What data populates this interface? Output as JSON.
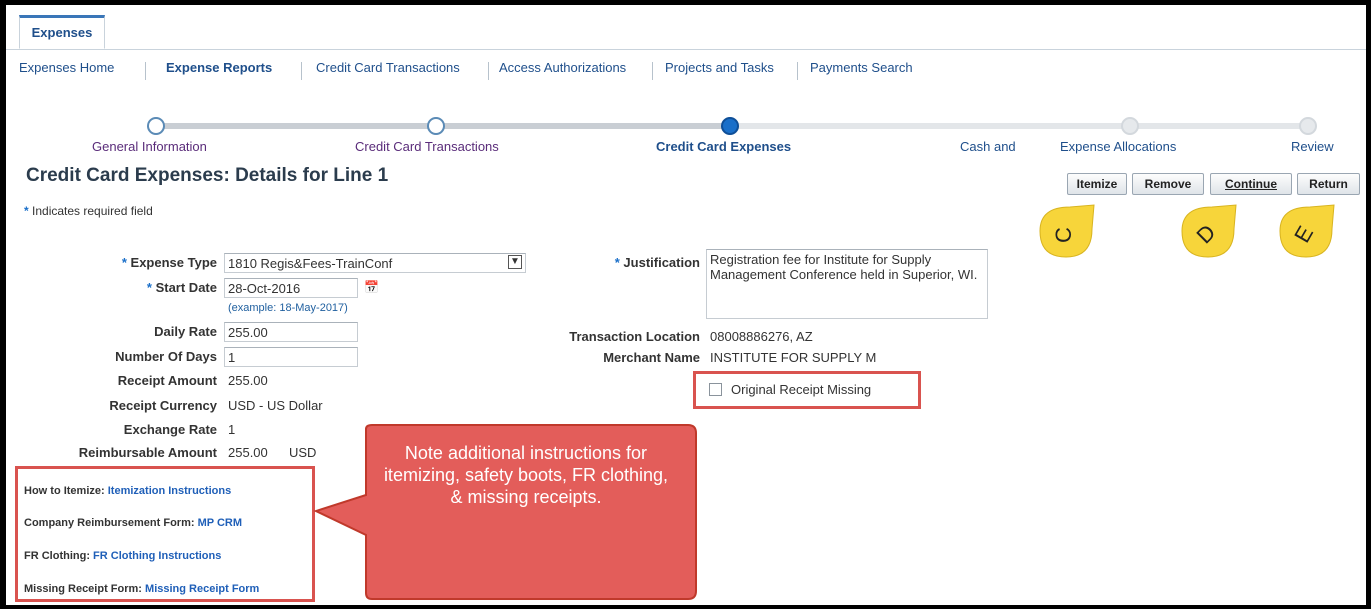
{
  "top_tab": "Expenses",
  "nav": [
    {
      "label": "Expenses Home",
      "active": false
    },
    {
      "label": "Expense Reports",
      "active": true
    },
    {
      "label": "Credit Card Transactions",
      "active": false
    },
    {
      "label": "Access Authorizations",
      "active": false
    },
    {
      "label": "Projects and Tasks",
      "active": false
    },
    {
      "label": "Payments Search",
      "active": false
    }
  ],
  "train": [
    {
      "label": "General Information",
      "state": "done"
    },
    {
      "label": "Credit Card Transactions",
      "state": "done"
    },
    {
      "label": "Credit Card Expenses",
      "state": "current"
    },
    {
      "label": "Cash and",
      "state": "todo"
    },
    {
      "label": "Expense Allocations",
      "state": "todo"
    },
    {
      "label": "Review",
      "state": "todo"
    }
  ],
  "page_title": "Credit Card Expenses: Details for Line 1",
  "buttons": {
    "itemize": "Itemize",
    "remove": "Remove",
    "continue": "Continue",
    "return": "Return"
  },
  "required_note": "Indicates required field",
  "required_star": "*",
  "form": {
    "expense_type_label": "Expense Type",
    "expense_type_value": "1810 Regis&Fees-TrainConf",
    "start_date_label": "Start Date",
    "start_date_value": "28-Oct-2016",
    "start_date_hint": "(example: 18-May-2017)",
    "daily_rate_label": "Daily Rate",
    "daily_rate_value": "255.00",
    "num_days_label": "Number Of Days",
    "num_days_value": "1",
    "receipt_amount_label": "Receipt Amount",
    "receipt_amount_value": "255.00",
    "receipt_currency_label": "Receipt Currency",
    "receipt_currency_value": "USD - US Dollar",
    "exchange_rate_label": "Exchange Rate",
    "exchange_rate_value": "1",
    "reimbursable_label": "Reimbursable Amount",
    "reimbursable_value": "255.00",
    "reimbursable_currency": "USD",
    "justification_label": "Justification",
    "justification_value": "Registration fee for Institute for Supply Management Conference held in Superior, WI.",
    "transaction_location_label": "Transaction Location",
    "transaction_location_value": "08008886276, AZ",
    "merchant_name_label": "Merchant Name",
    "merchant_name_value": "INSTITUTE FOR SUPPLY M",
    "receipt_missing_label": "Original Receipt Missing"
  },
  "instructions": [
    {
      "label": "How to Itemize:",
      "link": "Itemization Instructions"
    },
    {
      "label": "Company Reimbursement Form:",
      "link": "MP CRM"
    },
    {
      "label": "FR Clothing:",
      "link": "FR Clothing Instructions"
    },
    {
      "label": "Missing Receipt Form:",
      "link": "Missing Receipt Form"
    }
  ],
  "callout_text": "Note additional instructions for itemizing, safety boots, FR clothing, & missing receipts.",
  "markers": [
    "C",
    "D",
    "E"
  ],
  "colors": {
    "accent_blue": "#1a6fc9",
    "annotation_red": "#d9534f",
    "marker_yellow": "#f7d53a"
  }
}
